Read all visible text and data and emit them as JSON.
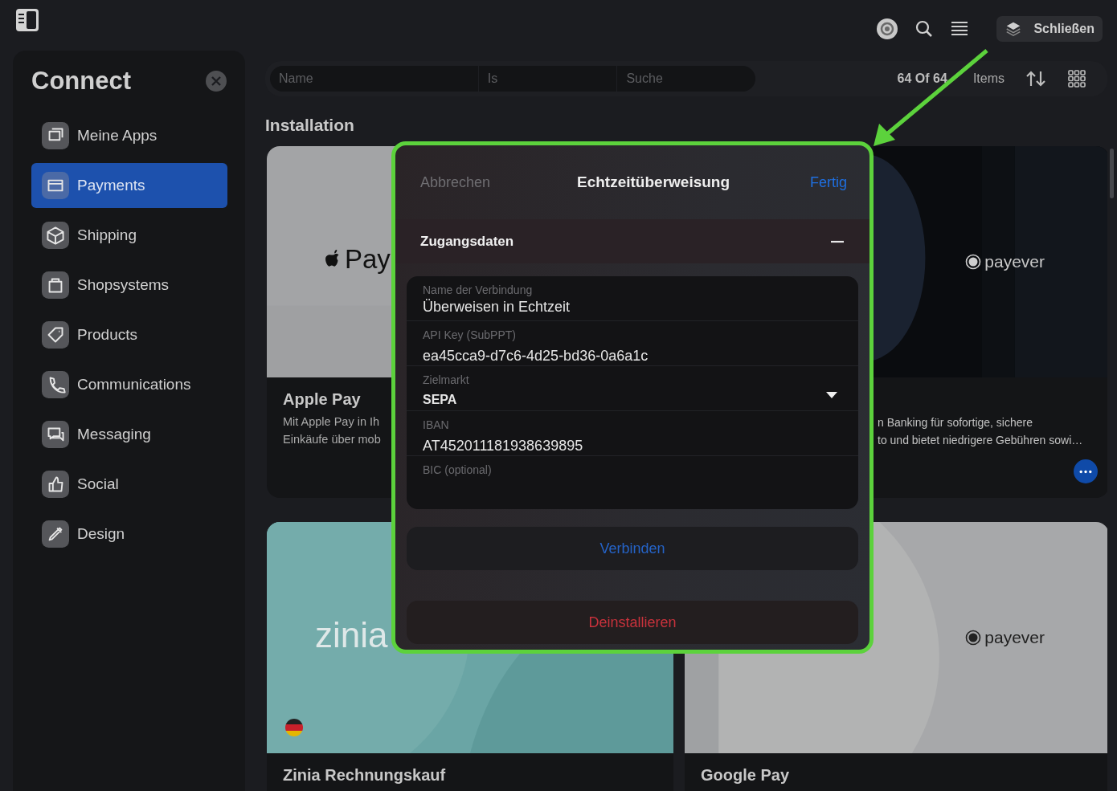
{
  "topbar": {
    "close_button": "Schließen"
  },
  "sidebar": {
    "title": "Connect",
    "items": [
      {
        "label": "Meine Apps",
        "selected": false
      },
      {
        "label": "Payments",
        "selected": true
      },
      {
        "label": "Shipping",
        "selected": false
      },
      {
        "label": "Shopsystems",
        "selected": false
      },
      {
        "label": "Products",
        "selected": false
      },
      {
        "label": "Communications",
        "selected": false
      },
      {
        "label": "Messaging",
        "selected": false
      },
      {
        "label": "Social",
        "selected": false
      },
      {
        "label": "Design",
        "selected": false
      }
    ]
  },
  "filter": {
    "columns": [
      {
        "placeholder": "Name"
      },
      {
        "placeholder": "Is"
      },
      {
        "placeholder": "Suche"
      }
    ],
    "count": "64 Of 64",
    "count_unit": "Items"
  },
  "section_title": "Installation",
  "cards": [
    {
      "kind": "applepay",
      "logo": "Pay",
      "title": "Apple Pay",
      "description_lines": [
        "Mit Apple Pay in Ih",
        "Einkäufe über mob"
      ]
    },
    {
      "kind": "payever-dark",
      "logo": "payever",
      "description_lines": [
        "n Banking für sofortige, sichere",
        "to und bietet niedrigere Gebühren sowi…"
      ],
      "menu_button": true
    },
    {
      "kind": "zinia",
      "logo": "zinia",
      "title": "Zinia Rechnungskauf"
    },
    {
      "kind": "payever-light",
      "logo": "payever",
      "title": "Google Pay"
    }
  ],
  "modal": {
    "cancel": "Abbrechen",
    "title": "Echtzeitüberweisung",
    "done": "Fertig",
    "section": {
      "title": "Zugangsdaten",
      "expanded": true
    },
    "fields": [
      {
        "kind": "text",
        "label": "Name der Verbindung",
        "value": "Überweisen in Echtzeit"
      },
      {
        "kind": "text",
        "label": "API Key (SubPPT)",
        "value": "ea45cca9-d7c6-4d25-bd36-0a6a1c"
      },
      {
        "kind": "select",
        "label": "Zielmarkt",
        "value": "SEPA"
      },
      {
        "kind": "text",
        "label": "IBAN",
        "value": "AT452011181938639895"
      },
      {
        "kind": "text",
        "label": "BIC (optional)"
      }
    ],
    "connect_button": "Verbinden",
    "uninstall_button": "Deinstallieren"
  }
}
